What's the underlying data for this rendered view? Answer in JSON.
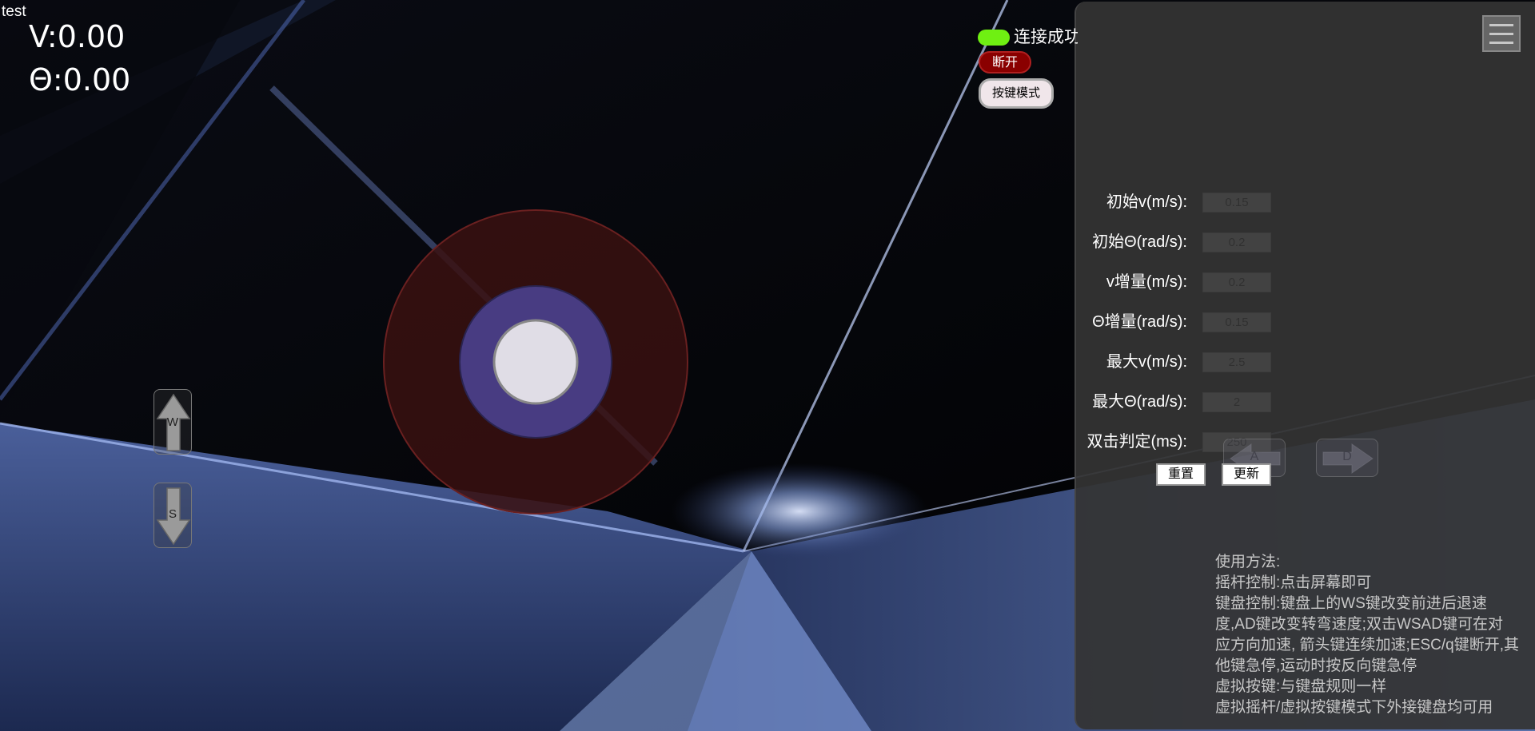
{
  "page": {
    "title": "test"
  },
  "readout": {
    "v": "V:0.00",
    "theta": "Θ:0.00"
  },
  "connection": {
    "status_text": "连接成功",
    "status_color": "#6ff012",
    "disconnect_label": "断开",
    "disconnect_color": "#8a0000",
    "mode_label": "按键模式"
  },
  "joystick": {
    "outer_color": "#3a1010",
    "ring_color": "#483c82",
    "knob_color": "#e0dde6",
    "x": 0,
    "y": 0
  },
  "keys": {
    "w": "W",
    "s": "S",
    "a": "A",
    "d": "D"
  },
  "settings": {
    "items": [
      {
        "label": "初始v(m/s):",
        "value": "0.15"
      },
      {
        "label": "初始Θ(rad/s):",
        "value": "0.2"
      },
      {
        "label": "v增量(m/s):",
        "value": "0.2"
      },
      {
        "label": "Θ增量(rad/s):",
        "value": "0.15"
      },
      {
        "label": "最大v(m/s):",
        "value": "2.5"
      },
      {
        "label": "最大Θ(rad/s):",
        "value": "2"
      },
      {
        "label": "双击判定(ms):",
        "value": "250"
      }
    ],
    "reset_label": "重置",
    "update_label": "更新"
  },
  "help": {
    "title": "使用方法:",
    "lines": [
      "摇杆控制:点击屏幕即可",
      "键盘控制:键盘上的WS键改变前进后退速",
      "度,AD键改变转弯速度;双击WSAD键可在对",
      "应方向加速, 箭头键连续加速;ESC/q键断开,其",
      "他键急停,运动时按反向键急停",
      "虚拟按键:与键盘规则一样",
      "虚拟摇杆/虚拟按键模式下外接键盘均可用"
    ]
  }
}
